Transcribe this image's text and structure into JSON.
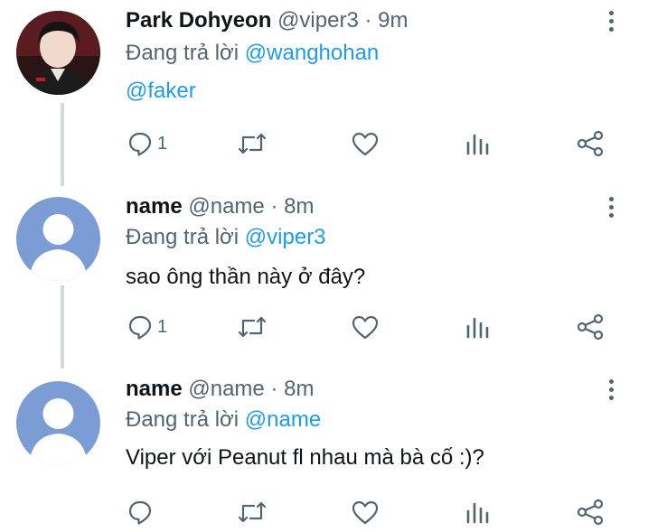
{
  "colors": {
    "link": "#1d9bf0",
    "muted": "#536471",
    "text": "#0f1419",
    "thread_line": "#cfd9de",
    "default_avatar_bg": "#7c9cd6"
  },
  "replying_prefix": "Đang trả lời",
  "tweets": [
    {
      "display_name": "Park Dohyeon",
      "handle": "@viper3",
      "separator": "·",
      "time": "9m",
      "reply_to": "@wanghohan",
      "text": "@faker",
      "reply_count": "1",
      "avatar": "profile-photo"
    },
    {
      "display_name": "name",
      "handle": "@name",
      "separator": "·",
      "time": "8m",
      "reply_to": "@viper3",
      "text": "sao ông thần này ở đây?",
      "reply_count": "1",
      "avatar": "default-user-icon"
    },
    {
      "display_name": "name",
      "handle": "@name",
      "separator": "·",
      "time": "8m",
      "reply_to": "@name",
      "text": "Viper với Peanut fl nhau mà bà cố :)?",
      "reply_count": "",
      "avatar": "default-user-icon"
    }
  ],
  "icons": [
    "reply-icon",
    "retweet-icon",
    "like-icon",
    "analytics-icon",
    "share-icon",
    "more-options-icon"
  ]
}
